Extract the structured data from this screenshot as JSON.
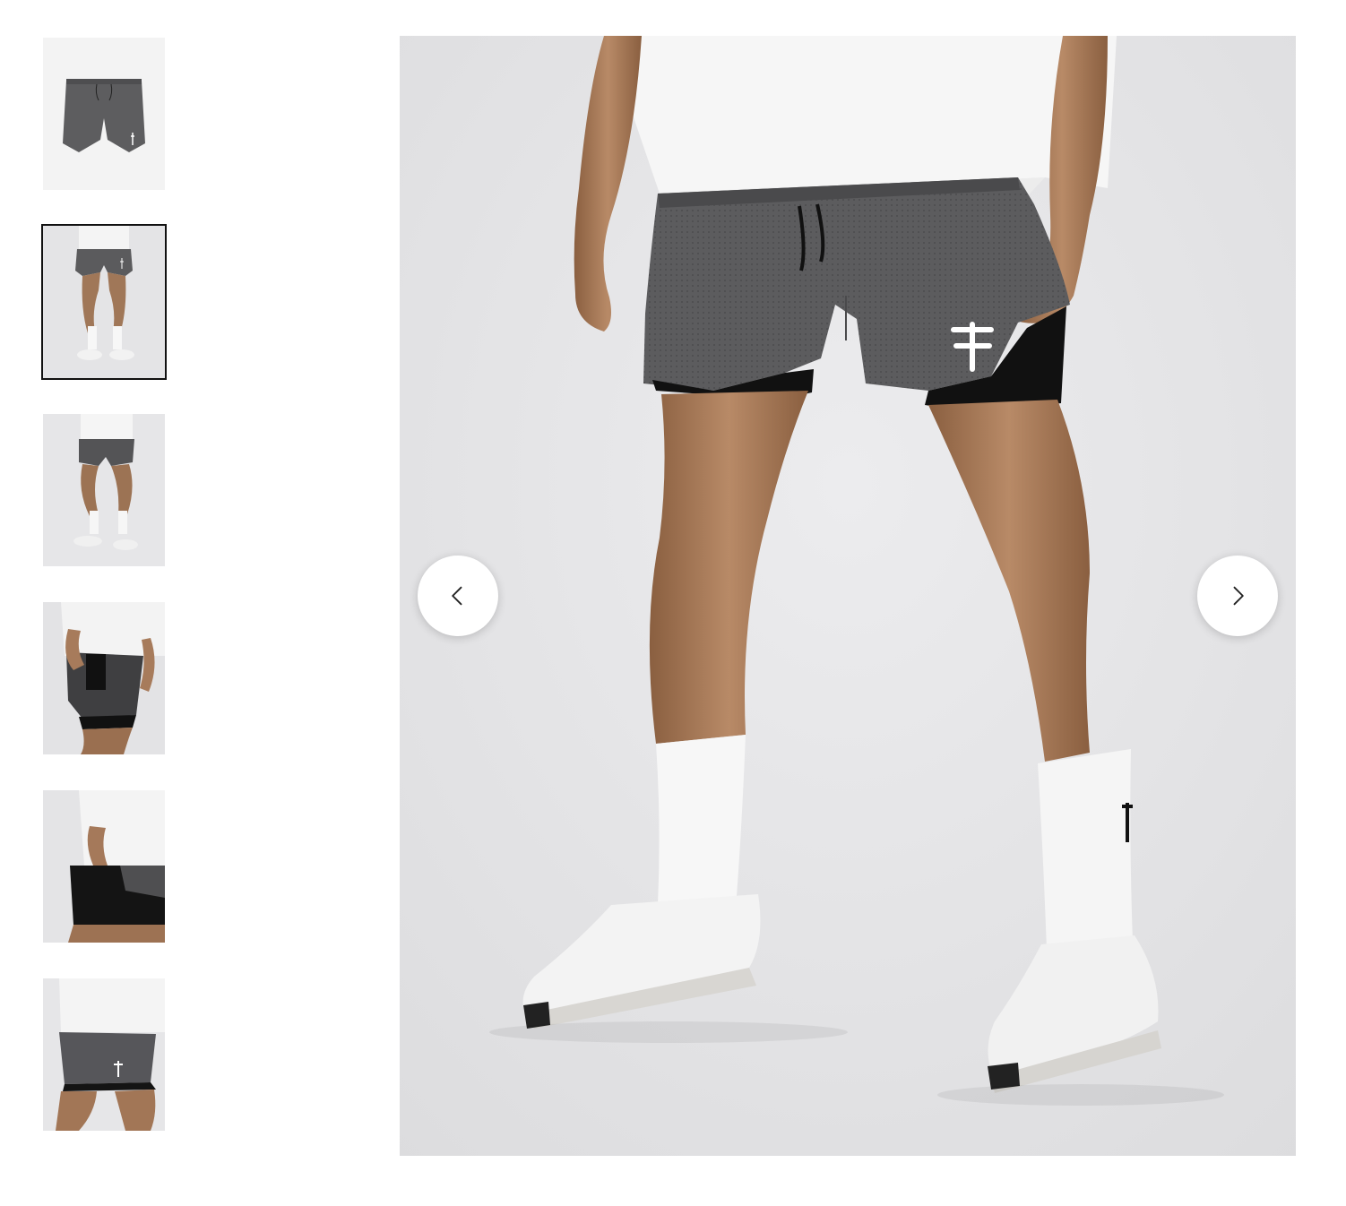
{
  "gallery": {
    "thumbnails": [
      {
        "name": "thumb-flat-lay",
        "alt": "shorts-flat-lay"
      },
      {
        "name": "thumb-front-model",
        "alt": "front-model",
        "active": true
      },
      {
        "name": "thumb-side-model",
        "alt": "side-model"
      },
      {
        "name": "thumb-phone-pocket",
        "alt": "phone-pocket"
      },
      {
        "name": "thumb-liner-detail",
        "alt": "liner-detail"
      },
      {
        "name": "thumb-logo-closeup",
        "alt": "logo-closeup"
      }
    ],
    "active_index": 1,
    "prev_icon": "chevron-left-icon",
    "next_icon": "chevron-right-icon"
  },
  "colors": {
    "background": "#ffffff",
    "photo_bg": "#e6e6e8",
    "shorts_gray": "#5b5b5d",
    "liner_black": "#111111",
    "active_outline": "#111111"
  }
}
